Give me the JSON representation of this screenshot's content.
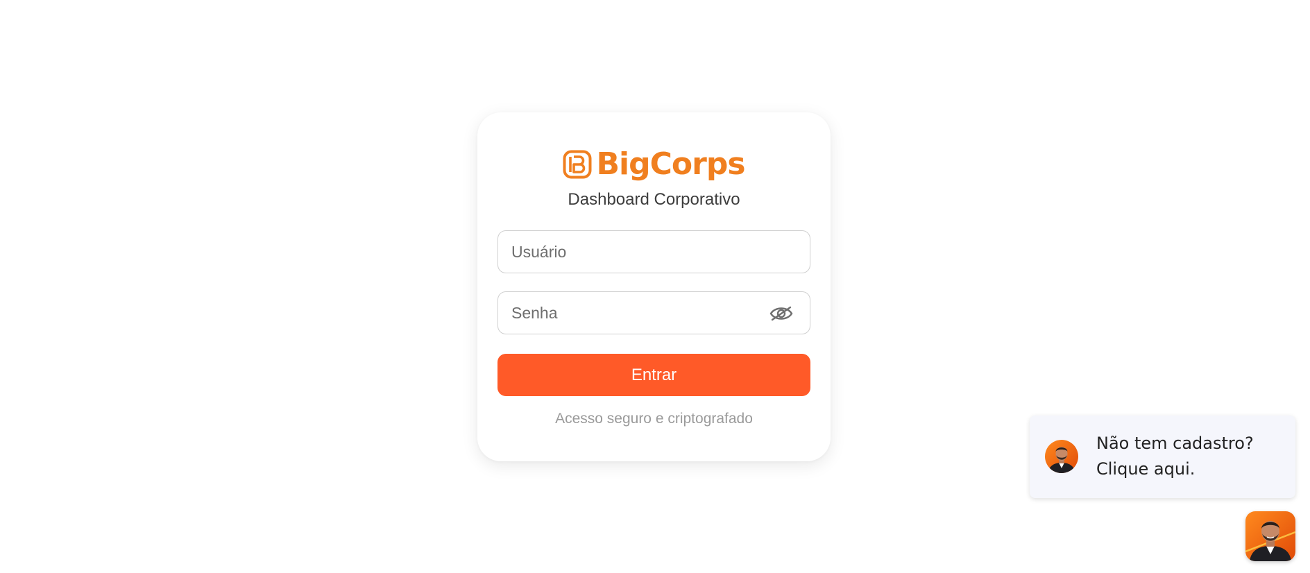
{
  "brand": {
    "name": "BigCorps",
    "color": "#F07F1F",
    "icon": "bigcorps-logo-icon"
  },
  "login": {
    "subtitle": "Dashboard Corporativo",
    "username_placeholder": "Usuário",
    "password_placeholder": "Senha",
    "password_toggle_icon": "eye-slash-icon",
    "submit_label": "Entrar",
    "submit_color": "#FF5A28",
    "security_note": "Acesso seguro e criptografado"
  },
  "chat_popup": {
    "line1": "Não tem cadastro?",
    "line2": "Clique aqui.",
    "avatar_icon": "agent-avatar-icon"
  },
  "chat_launcher": {
    "avatar_icon": "agent-avatar-icon"
  }
}
